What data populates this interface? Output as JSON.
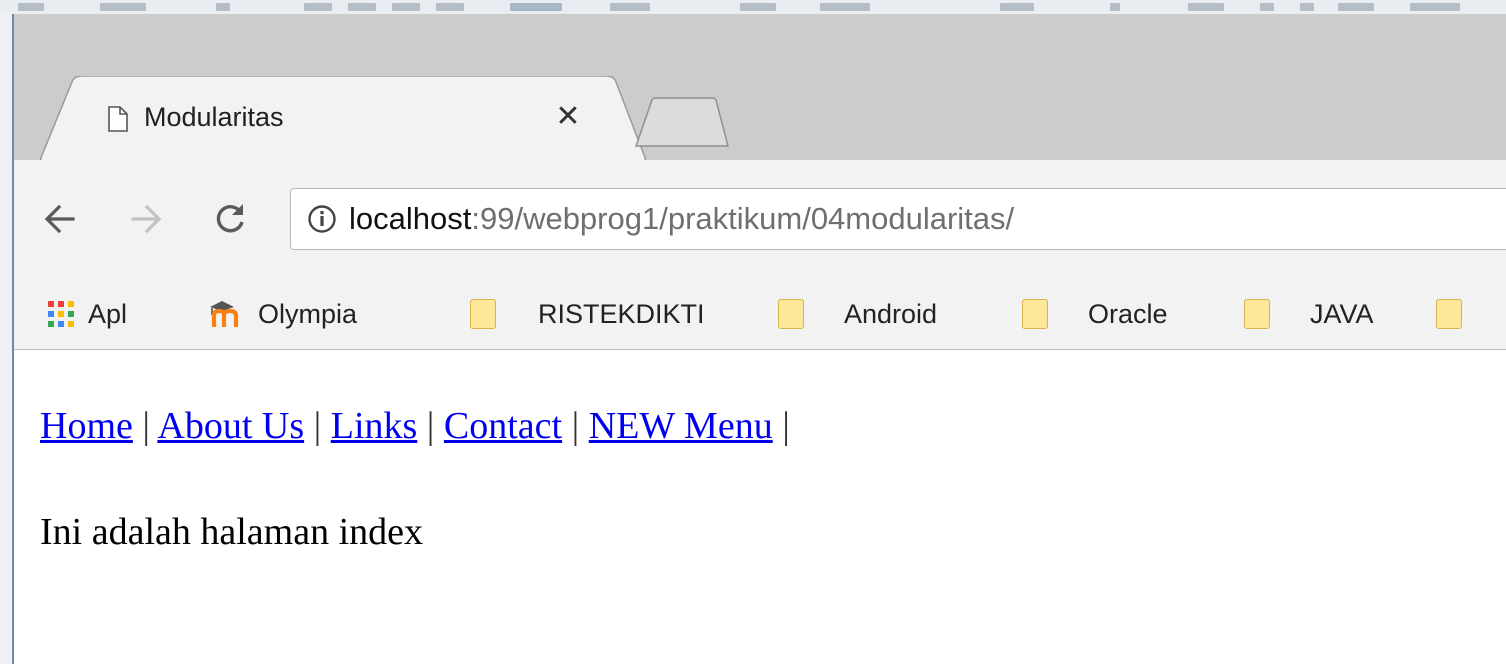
{
  "browser": {
    "tab": {
      "title": "Modularitas",
      "close_glyph": "✕",
      "icon": "page-icon"
    },
    "new_tab_icon": "new-tab-icon",
    "toolbar": {
      "back_icon": "back-arrow-icon",
      "forward_icon": "forward-arrow-icon",
      "reload_icon": "reload-icon",
      "address": {
        "info_icon": "info-icon",
        "host": "localhost",
        "rest": ":99/webprog1/praktikum/04modularitas/"
      }
    },
    "bookmarks": [
      {
        "label": "Apl",
        "icon": "apps-grid-icon"
      },
      {
        "label": "Olympia",
        "icon": "moodle-icon"
      },
      {
        "label": "RISTEKDIKTI",
        "icon": "folder-icon"
      },
      {
        "label": "Android",
        "icon": "folder-icon"
      },
      {
        "label": "Oracle",
        "icon": "folder-icon"
      },
      {
        "label": "JAVA",
        "icon": "folder-icon"
      }
    ]
  },
  "page": {
    "menu": [
      {
        "label": "Home"
      },
      {
        "label": "About Us"
      },
      {
        "label": "Links"
      },
      {
        "label": "Contact"
      },
      {
        "label": "NEW Menu"
      }
    ],
    "separator": "|",
    "body_text": "Ini adalah halaman index"
  },
  "colors": {
    "tab_strip": "#cccccc",
    "toolbar": "#f2f2f2",
    "link": "#0000ee",
    "folder": "#fde79a",
    "apps_grid": [
      "#e94235",
      "#fbbc04",
      "#34a853",
      "#4285f4"
    ]
  }
}
